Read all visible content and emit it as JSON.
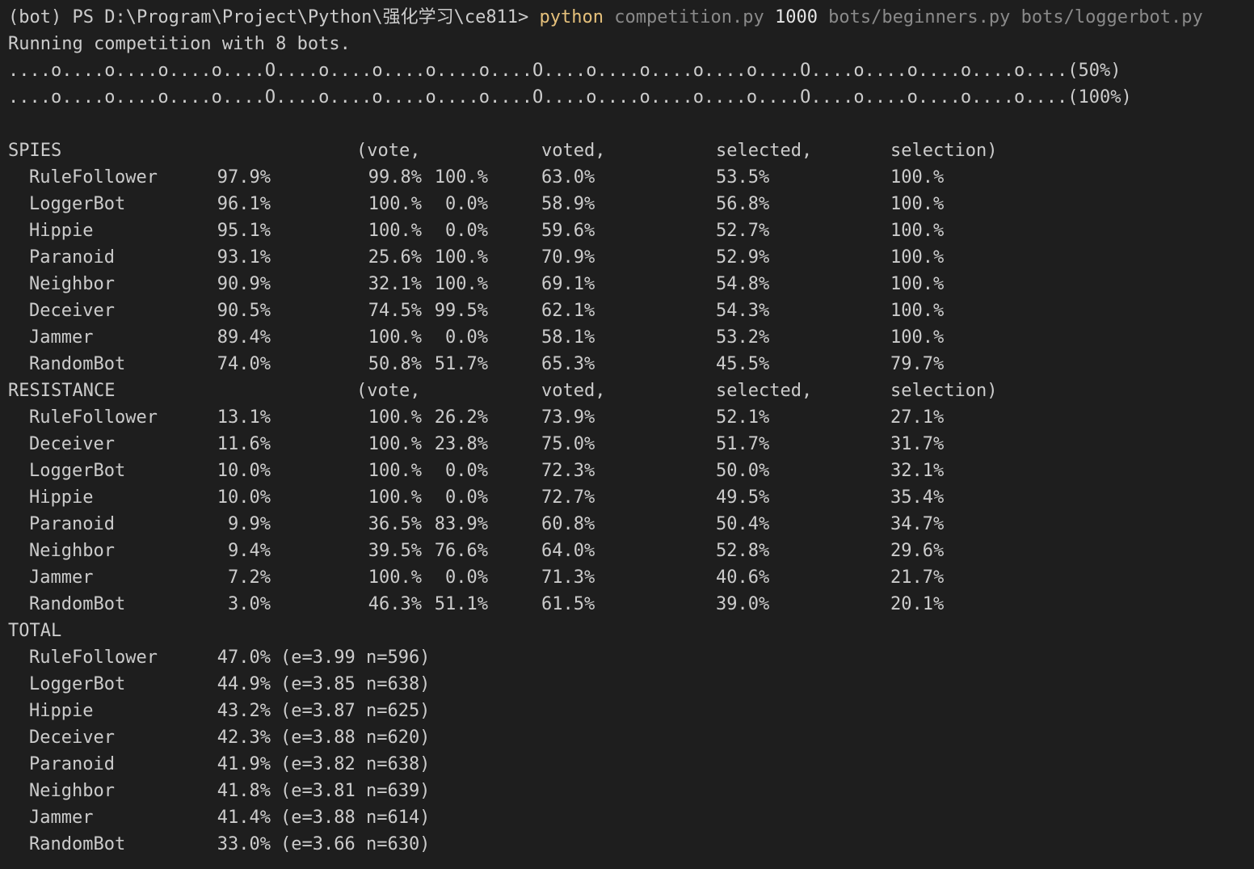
{
  "terminal": {
    "prompt": "(bot) PS D:\\Program\\Project\\Python\\强化学习\\ce811> ",
    "cmd_python": "python",
    "cmd_script": " competition.py ",
    "cmd_count": "1000",
    "cmd_bots": " bots/beginners.py bots/loggerbot.py",
    "running_msg": "Running competition with 8 bots.",
    "progress1": "....o....o....o....o....O....o....o....o....o....O....o....o....o....o....O....o....o....o....o....(50%)",
    "progress2": "....o....o....o....o....O....o....o....o....o....O....o....o....o....o....O....o....o....o....o....(100%)",
    "colors": {
      "background": "#1e1e1e",
      "text": "#cccccc",
      "python": "#e5c07b",
      "args": "#8a8a8a"
    }
  },
  "spies": {
    "header": {
      "title": "SPIES",
      "vote": "(vote,",
      "voted": "voted,",
      "selected": "selected,",
      "selection": "selection)"
    },
    "rows": [
      {
        "name": "RuleFollower",
        "win": "97.9%",
        "v1": "99.8%",
        "v2": "100.%",
        "voted": "63.0%",
        "selected": "53.5%",
        "selection": "100.%"
      },
      {
        "name": "LoggerBot",
        "win": "96.1%",
        "v1": "100.%",
        "v2": "0.0%",
        "voted": "58.9%",
        "selected": "56.8%",
        "selection": "100.%"
      },
      {
        "name": "Hippie",
        "win": "95.1%",
        "v1": "100.%",
        "v2": "0.0%",
        "voted": "59.6%",
        "selected": "52.7%",
        "selection": "100.%"
      },
      {
        "name": "Paranoid",
        "win": "93.1%",
        "v1": "25.6%",
        "v2": "100.%",
        "voted": "70.9%",
        "selected": "52.9%",
        "selection": "100.%"
      },
      {
        "name": "Neighbor",
        "win": "90.9%",
        "v1": "32.1%",
        "v2": "100.%",
        "voted": "69.1%",
        "selected": "54.8%",
        "selection": "100.%"
      },
      {
        "name": "Deceiver",
        "win": "90.5%",
        "v1": "74.5%",
        "v2": "99.5%",
        "voted": "62.1%",
        "selected": "54.3%",
        "selection": "100.%"
      },
      {
        "name": "Jammer",
        "win": "89.4%",
        "v1": "100.%",
        "v2": "0.0%",
        "voted": "58.1%",
        "selected": "53.2%",
        "selection": "100.%"
      },
      {
        "name": "RandomBot",
        "win": "74.0%",
        "v1": "50.8%",
        "v2": "51.7%",
        "voted": "65.3%",
        "selected": "45.5%",
        "selection": "79.7%"
      }
    ]
  },
  "resistance": {
    "header": {
      "title": "RESISTANCE",
      "vote": "(vote,",
      "voted": "voted,",
      "selected": "selected,",
      "selection": "selection)"
    },
    "rows": [
      {
        "name": "RuleFollower",
        "win": "13.1%",
        "v1": "100.%",
        "v2": "26.2%",
        "voted": "73.9%",
        "selected": "52.1%",
        "selection": "27.1%"
      },
      {
        "name": "Deceiver",
        "win": "11.6%",
        "v1": "100.%",
        "v2": "23.8%",
        "voted": "75.0%",
        "selected": "51.7%",
        "selection": "31.7%"
      },
      {
        "name": "LoggerBot",
        "win": "10.0%",
        "v1": "100.%",
        "v2": "0.0%",
        "voted": "72.3%",
        "selected": "50.0%",
        "selection": "32.1%"
      },
      {
        "name": "Hippie",
        "win": "10.0%",
        "v1": "100.%",
        "v2": "0.0%",
        "voted": "72.7%",
        "selected": "49.5%",
        "selection": "35.4%"
      },
      {
        "name": "Paranoid",
        "win": "9.9%",
        "v1": "36.5%",
        "v2": "83.9%",
        "voted": "60.8%",
        "selected": "50.4%",
        "selection": "34.7%"
      },
      {
        "name": "Neighbor",
        "win": "9.4%",
        "v1": "39.5%",
        "v2": "76.6%",
        "voted": "64.0%",
        "selected": "52.8%",
        "selection": "29.6%"
      },
      {
        "name": "Jammer",
        "win": "7.2%",
        "v1": "100.%",
        "v2": "0.0%",
        "voted": "71.3%",
        "selected": "40.6%",
        "selection": "21.7%"
      },
      {
        "name": "RandomBot",
        "win": "3.0%",
        "v1": "46.3%",
        "v2": "51.1%",
        "voted": "61.5%",
        "selected": "39.0%",
        "selection": "20.1%"
      }
    ]
  },
  "total": {
    "title": "TOTAL",
    "rows": [
      {
        "name": "RuleFollower",
        "win": "47.0%",
        "stats": "(e=3.99 n=596)"
      },
      {
        "name": "LoggerBot",
        "win": "44.9%",
        "stats": "(e=3.85 n=638)"
      },
      {
        "name": "Hippie",
        "win": "43.2%",
        "stats": "(e=3.87 n=625)"
      },
      {
        "name": "Deceiver",
        "win": "42.3%",
        "stats": "(e=3.88 n=620)"
      },
      {
        "name": "Paranoid",
        "win": "41.9%",
        "stats": "(e=3.82 n=638)"
      },
      {
        "name": "Neighbor",
        "win": "41.8%",
        "stats": "(e=3.81 n=639)"
      },
      {
        "name": "Jammer",
        "win": "41.4%",
        "stats": "(e=3.88 n=614)"
      },
      {
        "name": "RandomBot",
        "win": "33.0%",
        "stats": "(e=3.66 n=630)"
      }
    ]
  }
}
